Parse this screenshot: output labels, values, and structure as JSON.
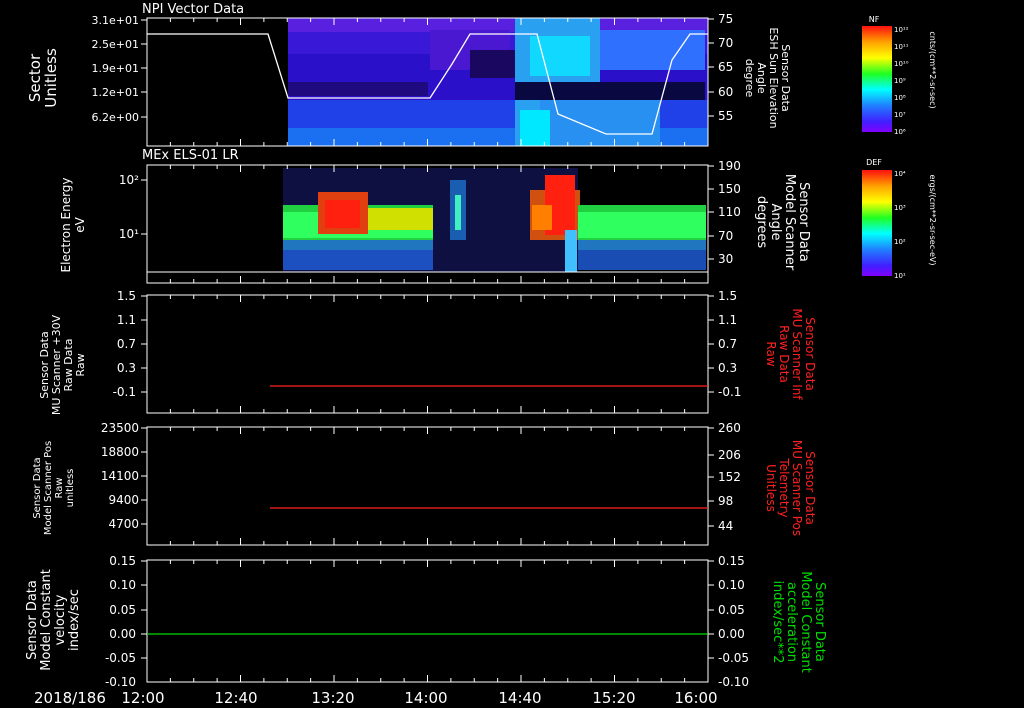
{
  "date_label": "2018/186",
  "x_ticks": [
    "12:00",
    "12:40",
    "13:20",
    "14:00",
    "14:40",
    "15:20",
    "16:00"
  ],
  "panel1": {
    "title": "NPI Vector Data",
    "left_label": [
      "Sector",
      "Unitless"
    ],
    "left_ticks": [
      "3.1e+01",
      "2.5e+01",
      "1.9e+01",
      "1.2e+01",
      "6.2e+00"
    ],
    "right_label": [
      "Sensor Data",
      "ESH Sun Elevation",
      "Angle",
      "degree"
    ],
    "right_ticks": [
      "75",
      "70",
      "65",
      "60",
      "55"
    ],
    "colorbar_top": "NF",
    "colorbar_ticks": [
      "10¹²",
      "10¹¹",
      "10¹⁰",
      "10⁹",
      "10⁸",
      "10⁷",
      "10⁶"
    ],
    "colorbar_units": "cnts/(cm**2-sr-sec)"
  },
  "panel2": {
    "title": "MEx ELS-01 LR",
    "left_label": [
      "Electron Energy",
      "eV"
    ],
    "left_ticks": [
      "10²",
      "10¹"
    ],
    "right_label": [
      "Sensor Data",
      "Model Scanner",
      "Angle",
      "degrees"
    ],
    "right_ticks": [
      "190",
      "150",
      "110",
      "70",
      "30"
    ],
    "colorbar_top": "DEF",
    "colorbar_ticks": [
      "10⁴",
      "10³",
      "10²",
      "10¹"
    ],
    "colorbar_units": "ergs/(cm**2-sr-sec-eV)"
  },
  "panel3": {
    "left_label": [
      "Sensor Data",
      "MU Scanner +30V",
      "Raw Data",
      "Raw"
    ],
    "left_ticks": [
      "1.5",
      "1.1",
      "0.7",
      "0.3",
      "-0.1"
    ],
    "right_label": [
      "Sensor Data",
      "MU Scanner Inf",
      "Raw Data",
      "Raw"
    ],
    "right_ticks": [
      "1.5",
      "1.1",
      "0.7",
      "0.3",
      "-0.1"
    ]
  },
  "panel4": {
    "left_label": [
      "Sensor Data",
      "Model Scanner Pos",
      "Raw",
      "unitless"
    ],
    "left_ticks": [
      "23500",
      "18800",
      "14100",
      "9400",
      "4700"
    ],
    "right_label": [
      "Sensor Data",
      "MU Scanner Pos",
      "Telemetry",
      "Unitless"
    ],
    "right_ticks": [
      "260",
      "206",
      "152",
      "98",
      "44"
    ]
  },
  "panel5": {
    "left_label": [
      "Sensor Data",
      "Model Constant",
      "velocity",
      "index/sec"
    ],
    "left_ticks": [
      "0.15",
      "0.10",
      "0.05",
      "0.00",
      "-0.05",
      "-0.10"
    ],
    "right_label": [
      "Sensor Data",
      "Model Constant",
      "acceleration",
      "index/sec**2"
    ],
    "right_ticks": [
      "0.15",
      "0.10",
      "0.05",
      "0.00",
      "-0.05",
      "-0.10"
    ]
  },
  "colors": {
    "background": "#000000",
    "axis": "#ffffff",
    "red_trace": "#ff2020",
    "green_trace": "#00dd00",
    "red_label": "#ff2020",
    "green_label": "#00dd00"
  },
  "chart_data": [
    {
      "type": "heatmap",
      "title": "NPI Vector Data",
      "x_range": [
        "12:00",
        "16:00"
      ],
      "overlay_line": {
        "axis": "right",
        "x": [
          "12:00",
          "13:00",
          "13:10",
          "14:10",
          "14:25",
          "14:35",
          "15:05",
          "15:15",
          "15:40",
          "15:55",
          "16:00"
        ],
        "y": [
          71.5,
          71.5,
          59.5,
          59.5,
          66,
          71.5,
          71.5,
          55,
          51,
          70,
          71.5
        ]
      }
    },
    {
      "type": "heatmap",
      "title": "MEx ELS-01 LR",
      "x_range": [
        "12:00",
        "16:00"
      ]
    },
    {
      "type": "line",
      "series": [
        {
          "x": [
            "12:50",
            "16:00"
          ],
          "values": [
            0,
            0
          ]
        }
      ],
      "ylim": [
        -0.1,
        1.5
      ]
    },
    {
      "type": "line",
      "series": [
        {
          "x": [
            "12:50",
            "16:00"
          ],
          "values": [
            8300,
            8300
          ]
        }
      ],
      "ylim": [
        0,
        23500
      ]
    },
    {
      "type": "line",
      "series": [
        {
          "x": [
            "12:00",
            "16:00"
          ],
          "values": [
            0,
            0
          ]
        }
      ],
      "ylim": [
        -0.1,
        0.15
      ]
    }
  ]
}
